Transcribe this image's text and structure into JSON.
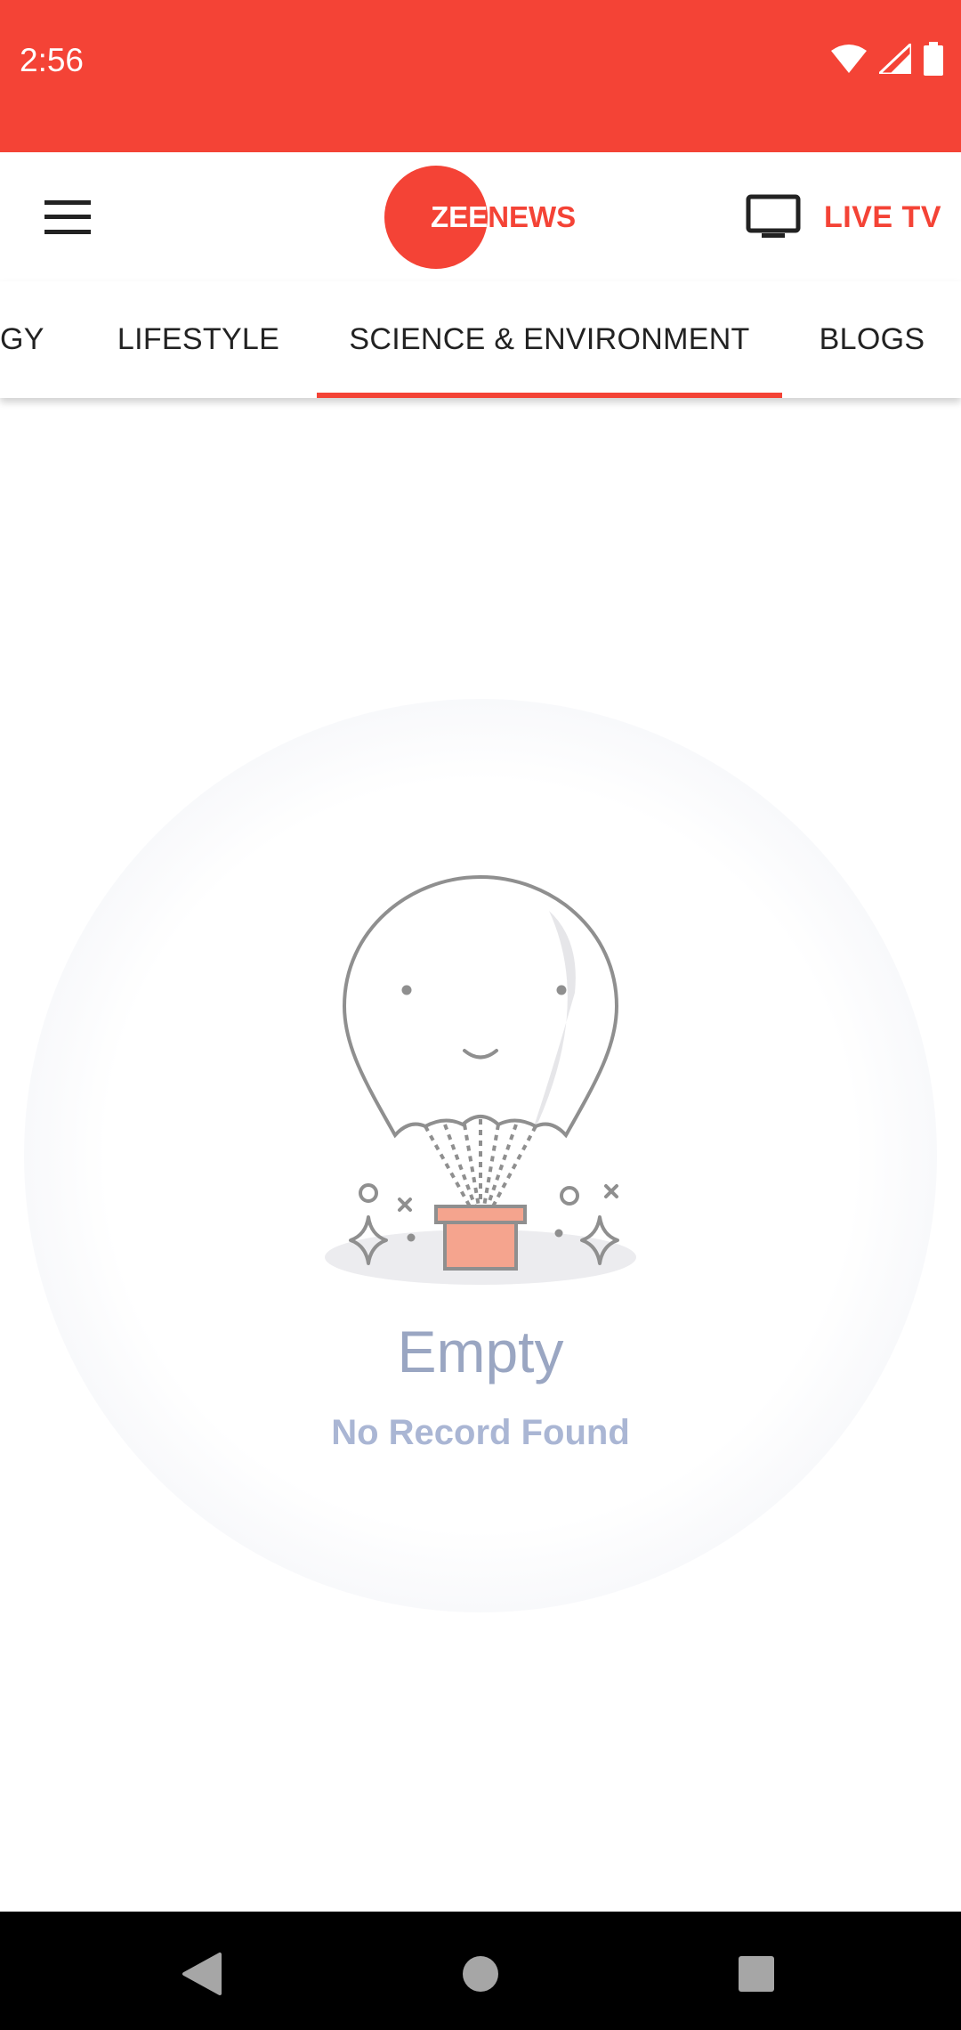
{
  "status_bar": {
    "time": "2:56",
    "icons": [
      "wifi-icon",
      "signal-icon",
      "battery-icon"
    ],
    "background": "#f44336"
  },
  "app_bar": {
    "logo": {
      "zee": "ZEE",
      "news": "NEWS"
    },
    "live_tv_label": "LIVE TV",
    "accent": "#f44336"
  },
  "tabs": {
    "items": [
      {
        "label": "GY"
      },
      {
        "label": "LIFESTYLE"
      },
      {
        "label": "SCIENCE & ENVIRONMENT",
        "selected": true
      },
      {
        "label": "BLOGS"
      }
    ]
  },
  "empty_state": {
    "title": "Empty",
    "subtitle": "No Record Found"
  },
  "nav_bar": {
    "buttons": [
      "back-icon",
      "home-icon",
      "recents-icon"
    ]
  }
}
